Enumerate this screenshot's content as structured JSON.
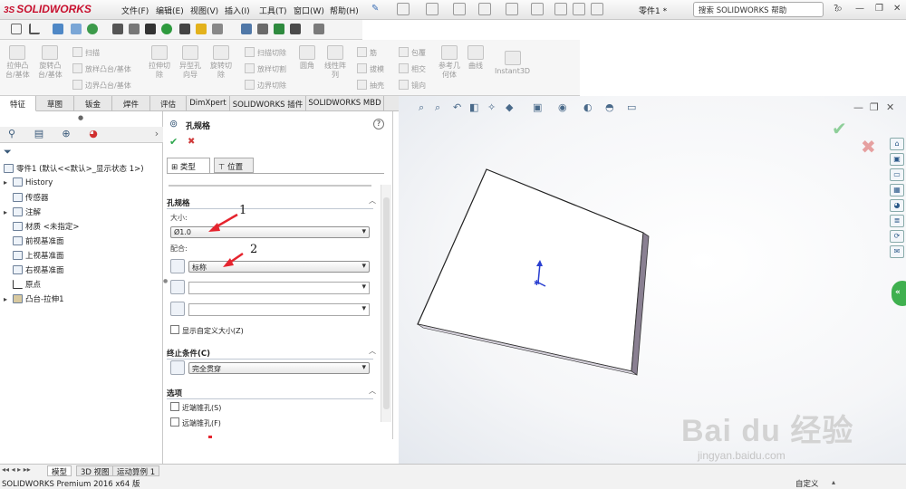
{
  "app": {
    "title_part": "零件1 *",
    "brand": "SOLIDWORKS",
    "version": "SOLIDWORKS Premium 2016 x64 版"
  },
  "menu": [
    "文件(F)",
    "编辑(E)",
    "视图(V)",
    "插入(I)",
    "工具(T)",
    "窗口(W)",
    "帮助(H)"
  ],
  "help_search": {
    "placeholder": "搜索 SOLIDWORKS 帮助"
  },
  "ribbon": {
    "big": [
      "拉伸凸\n台/基体",
      "旋转凸\n台/基体",
      "拉伸切\n除",
      "异型孔\n向导",
      "旋转切\n除",
      "圆角",
      "线性阵\n列",
      "参考几\n何体",
      "曲线",
      "Instant3D"
    ],
    "small": [
      "扫描",
      "放样凸台/基体",
      "边界凸台/基体",
      "扫描切除",
      "放样切割",
      "边界切除",
      "筋",
      "拔模",
      "抽壳",
      "包覆",
      "相交",
      "镜向"
    ]
  },
  "tabs": [
    "特征",
    "草图",
    "钣金",
    "焊件",
    "评估",
    "DimXpert",
    "SOLIDWORKS 插件",
    "SOLIDWORKS MBD"
  ],
  "tree": {
    "root": "零件1 (默认<<默认>_显示状态 1>)",
    "items": [
      "History",
      "传感器",
      "注解",
      "材质 <未指定>",
      "前视基准面",
      "上视基准面",
      "右视基准面",
      "原点",
      "凸台-拉伸1"
    ]
  },
  "pm": {
    "title": "孔规格",
    "subtabs": [
      "类型",
      "位置"
    ],
    "hole_spec": {
      "header": "孔规格",
      "size_label": "大小:",
      "size_value": "Ø1.0",
      "fit_label": "配合:",
      "fit_value": "标称",
      "show_custom": "显示自定义大小(Z)"
    },
    "end_condition": {
      "header": "终止条件(C)",
      "value": "完全贯穿"
    },
    "options": {
      "header": "选项",
      "items": [
        "近端锥孔(S)",
        "远端锥孔(F)"
      ]
    }
  },
  "annotations": [
    "1",
    "2"
  ],
  "bottom_tabs": [
    "模型",
    "3D 视图",
    "运动算例 1"
  ],
  "status": {
    "right": "自定义"
  },
  "watermark": {
    "text": "Bai du 经验",
    "url": "jingyan.baidu.com"
  },
  "colors": {
    "accent": "#c8102e",
    "ok": "#2fa84f",
    "cancel": "#d03c3c"
  }
}
